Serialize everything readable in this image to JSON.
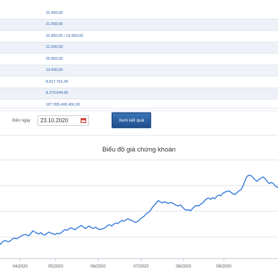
{
  "summary_values": [
    "21.450,00",
    "21.550,00",
    "22.850,00 / 19.950,00",
    "21.000,00",
    "26.850,00",
    "13.400,00",
    "8.817.761,00",
    "8.270.644,00",
    "187.395.406.450,00"
  ],
  "filter": {
    "to_label": "Đến ngày",
    "to_date": "23.10.2020",
    "calendar_icon": "calendar-icon",
    "submit_label": "Xem kết quả",
    "submit_color": "#2b5f9e"
  },
  "chart_data": {
    "type": "line",
    "title": "Biểu đồ giá chứng khoán",
    "x_tick_labels": [
      "04/2020",
      "05/2020",
      "06/2020",
      "07/2020",
      "08/2020",
      "09/2020"
    ],
    "line_color": "#3b7ddd",
    "grid": "horizontal",
    "series": [
      {
        "values": [
          0.2,
          0.18,
          0.22,
          0.24,
          0.23,
          0.22,
          0.24,
          0.27,
          0.28,
          0.27,
          0.29,
          0.31,
          0.33,
          0.34,
          0.33,
          0.32,
          0.36,
          0.4,
          0.38,
          0.36,
          0.35,
          0.37,
          0.34,
          0.33,
          0.36,
          0.38,
          0.36,
          0.35,
          0.34,
          0.36,
          0.35,
          0.37,
          0.4,
          0.42,
          0.41,
          0.44,
          0.45,
          0.43,
          0.42,
          0.45,
          0.47,
          0.49,
          0.46,
          0.44,
          0.46,
          0.48,
          0.45,
          0.44,
          0.46,
          0.44,
          0.42,
          0.43,
          0.44,
          0.46,
          0.49,
          0.5,
          0.48,
          0.51,
          0.53,
          0.52,
          0.55,
          0.57,
          0.56,
          0.58,
          0.6,
          0.58,
          0.57,
          0.55,
          0.54,
          0.56,
          0.59,
          0.62,
          0.64,
          0.68,
          0.7,
          0.73,
          0.78,
          0.82,
          0.86,
          0.9,
          0.88,
          0.86,
          0.88,
          0.87,
          0.85,
          0.87,
          0.86,
          0.84,
          0.82,
          0.81,
          0.83,
          0.79,
          0.76,
          0.74,
          0.75,
          0.73,
          0.77,
          0.8,
          0.82,
          0.81,
          0.84,
          0.86,
          0.9,
          0.93,
          0.94,
          0.92,
          0.95,
          0.93,
          0.97,
          0.99,
          0.98,
          1.02,
          1.04,
          1.05,
          1.06,
          1.04,
          1.01,
          1.0,
          1.03,
          1.06,
          1.08,
          1.14,
          1.23,
          1.3,
          1.32,
          1.31,
          1.28,
          1.24,
          1.22,
          1.25,
          1.27,
          1.29,
          1.26,
          1.21,
          1.18,
          1.2,
          1.18,
          1.14,
          1.12,
          1.1
        ]
      }
    ]
  }
}
